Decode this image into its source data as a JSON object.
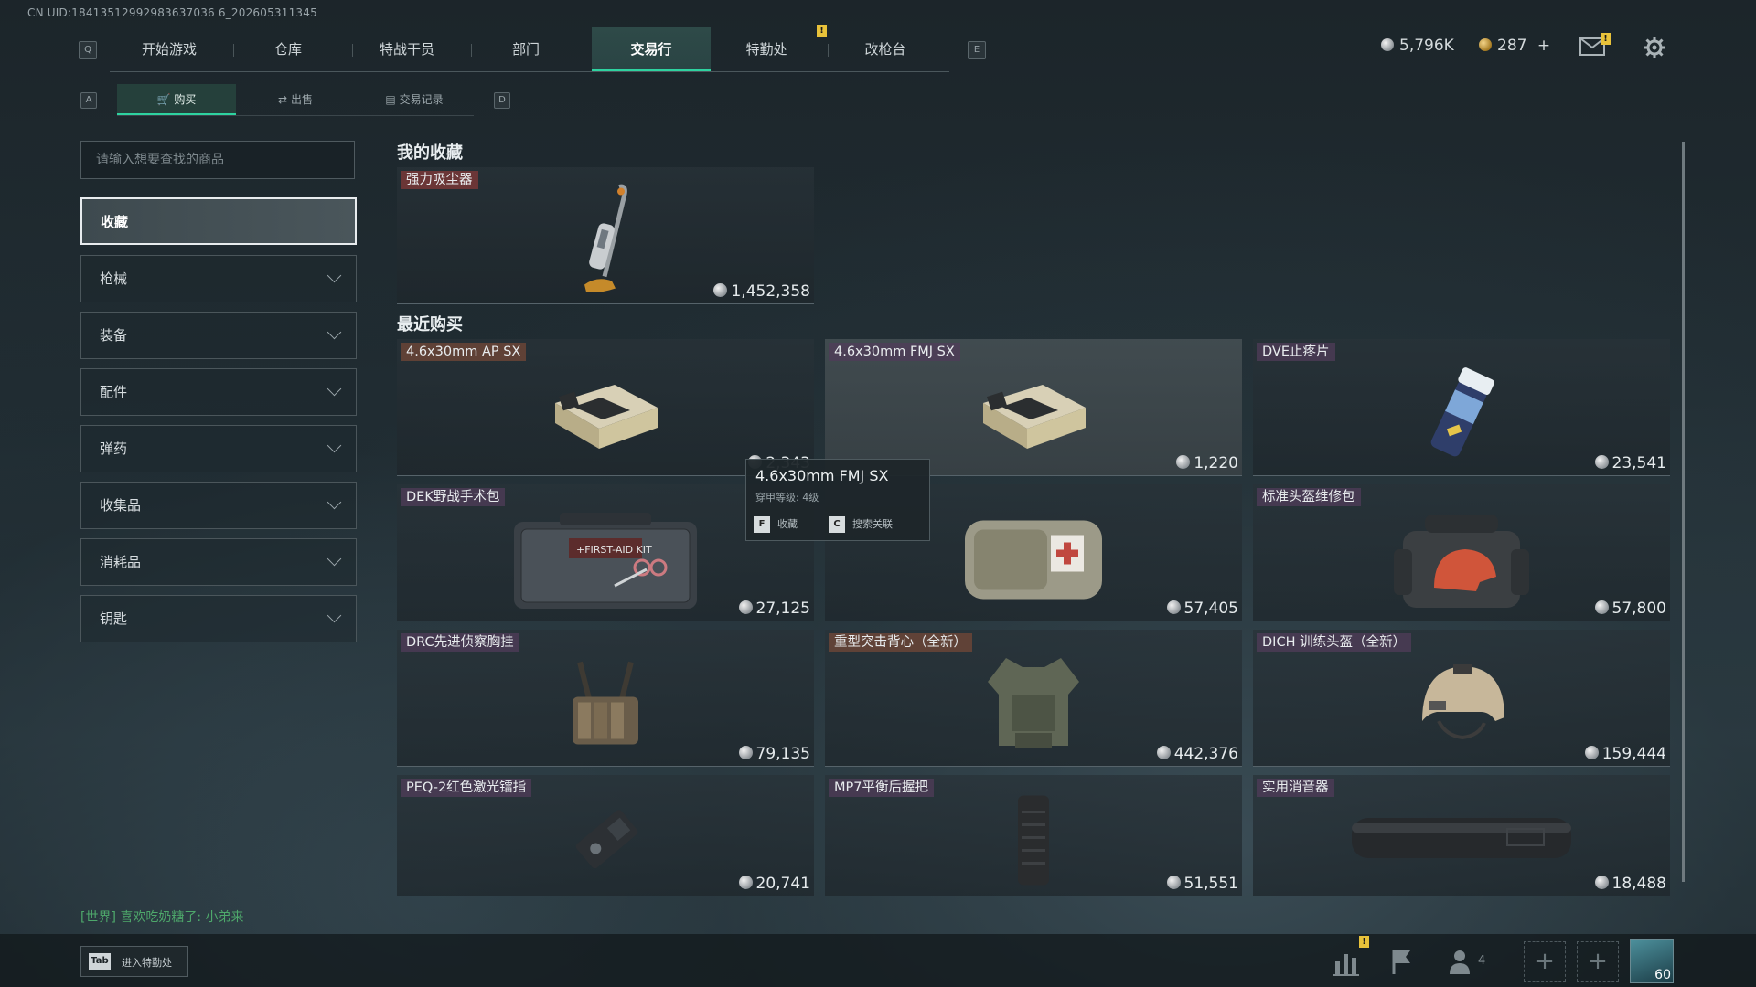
{
  "uid": "CN UID:18413512992983637036 6_202605311345",
  "nav": {
    "key_left": "Q",
    "key_right": "E",
    "tabs": [
      "开始游戏",
      "仓库",
      "特战干员",
      "部门",
      "交易行",
      "特勤处",
      "改枪台"
    ],
    "active": "交易行",
    "alert": "!"
  },
  "currency": {
    "silver": "5,796K",
    "gold": "287",
    "gold_add": "+",
    "mail_alert": "!"
  },
  "subnav": {
    "key_left": "A",
    "key_right": "D",
    "tabs": [
      "购买",
      "出售",
      "交易记录"
    ],
    "active": "购买"
  },
  "search": {
    "placeholder": "请输入想要查找的商品"
  },
  "categories": [
    "收藏",
    "枪械",
    "装备",
    "配件",
    "弹药",
    "收集品",
    "消耗品",
    "钥匙"
  ],
  "active_category": "收藏",
  "favorites": {
    "title": "我的收藏",
    "items": [
      {
        "name": "强力吸尘器",
        "price": "1,452,358",
        "tag_color": "#7a3b3b"
      }
    ]
  },
  "recent": {
    "title": "最近购买",
    "items": [
      {
        "name": "4.6x30mm AP SX",
        "price": "2,343"
      },
      {
        "name": "4.6x30mm FMJ SX",
        "price": "1,220"
      },
      {
        "name": "DVE止疼片",
        "price": "23,541"
      },
      {
        "name": "DEK野战手术包",
        "price": "27,125"
      },
      {
        "name": "",
        "price": "57,405"
      },
      {
        "name": "标准头盔维修包",
        "price": "57,800"
      },
      {
        "name": "DRC先进侦察胸挂",
        "price": "79,135"
      },
      {
        "name": "重型突击背心（全新）",
        "price": "442,376"
      },
      {
        "name": "DICH 训练头盔（全新）",
        "price": "159,444"
      },
      {
        "name": "PEQ-2红色激光镭指",
        "price": "20,741"
      },
      {
        "name": "MP7平衡后握把",
        "price": "51,551"
      },
      {
        "name": "实用消音器",
        "price": "18,488"
      }
    ]
  },
  "tooltip": {
    "title": "4.6x30mm FMJ SX",
    "detail": "穿甲等级: 4级",
    "actions": [
      {
        "key": "F",
        "label": "收藏"
      },
      {
        "key": "C",
        "label": "搜索关联"
      }
    ]
  },
  "chat": {
    "channel": "[世界]",
    "message": "喜欢吃奶糖了: 小弟来"
  },
  "bottom": {
    "tab_key": "Tab",
    "tab_label": "进入特勤处",
    "squad_count": "4",
    "level": "60",
    "alert": "!"
  }
}
